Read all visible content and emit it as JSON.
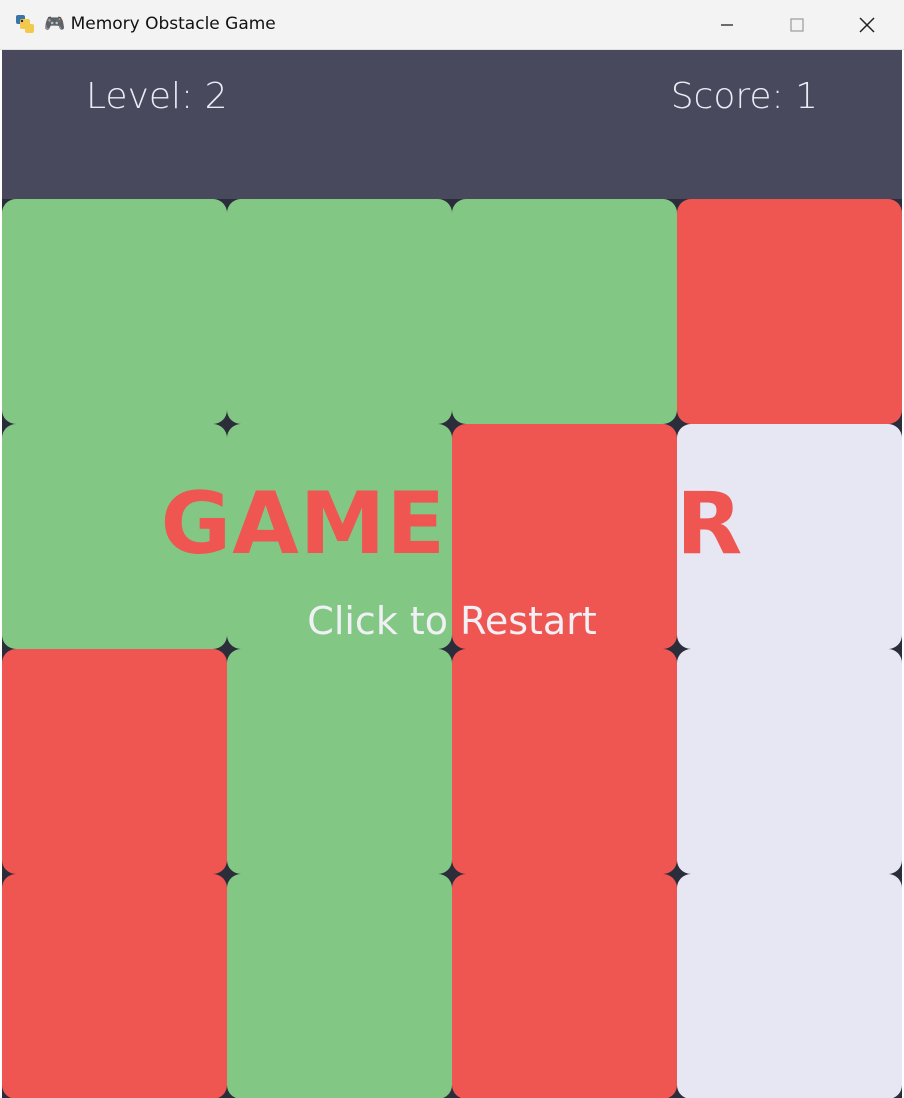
{
  "window": {
    "title": "🎮 Memory Obstacle Game",
    "app_icon": "python-icon",
    "controls": [
      "minimize-icon",
      "maximize-icon",
      "close-icon"
    ]
  },
  "hud": {
    "level_text": "Level: 2",
    "score_text": "Score: 1"
  },
  "overlay": {
    "title": "GAME OVER",
    "subtitle": "Click to Restart"
  },
  "board": {
    "rows": 4,
    "cols": 4,
    "tiles": [
      [
        "green",
        "green",
        "green",
        "red"
      ],
      [
        "green",
        "green",
        "red",
        "pale"
      ],
      [
        "red",
        "green",
        "red",
        "pale"
      ],
      [
        "red",
        "green",
        "red",
        "pale"
      ]
    ],
    "colors": {
      "green": "#82c884",
      "red": "#ef5551",
      "pale": "#e7e6f3",
      "hud_bg": "#48495c",
      "grid_bg": "#2c2d3b"
    }
  }
}
